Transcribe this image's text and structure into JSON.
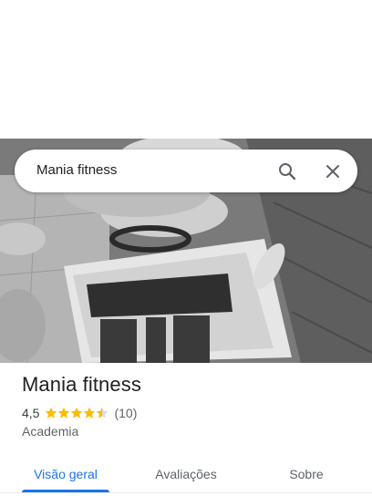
{
  "search": {
    "query": "Mania fitness"
  },
  "icons": {
    "search": "search-icon",
    "close": "close-icon",
    "star": "star-icon"
  },
  "place": {
    "name": "Mania fitness",
    "rating_text": "4,5",
    "rating": 4.5,
    "reviews_text": "(10)",
    "category": "Academia"
  },
  "tabs": [
    {
      "label": "Visão geral",
      "active": true
    },
    {
      "label": "Avaliações",
      "active": false
    },
    {
      "label": "Sobre",
      "active": false
    }
  ],
  "colors": {
    "accent": "#1a73e8",
    "star": "#fbbc04"
  }
}
